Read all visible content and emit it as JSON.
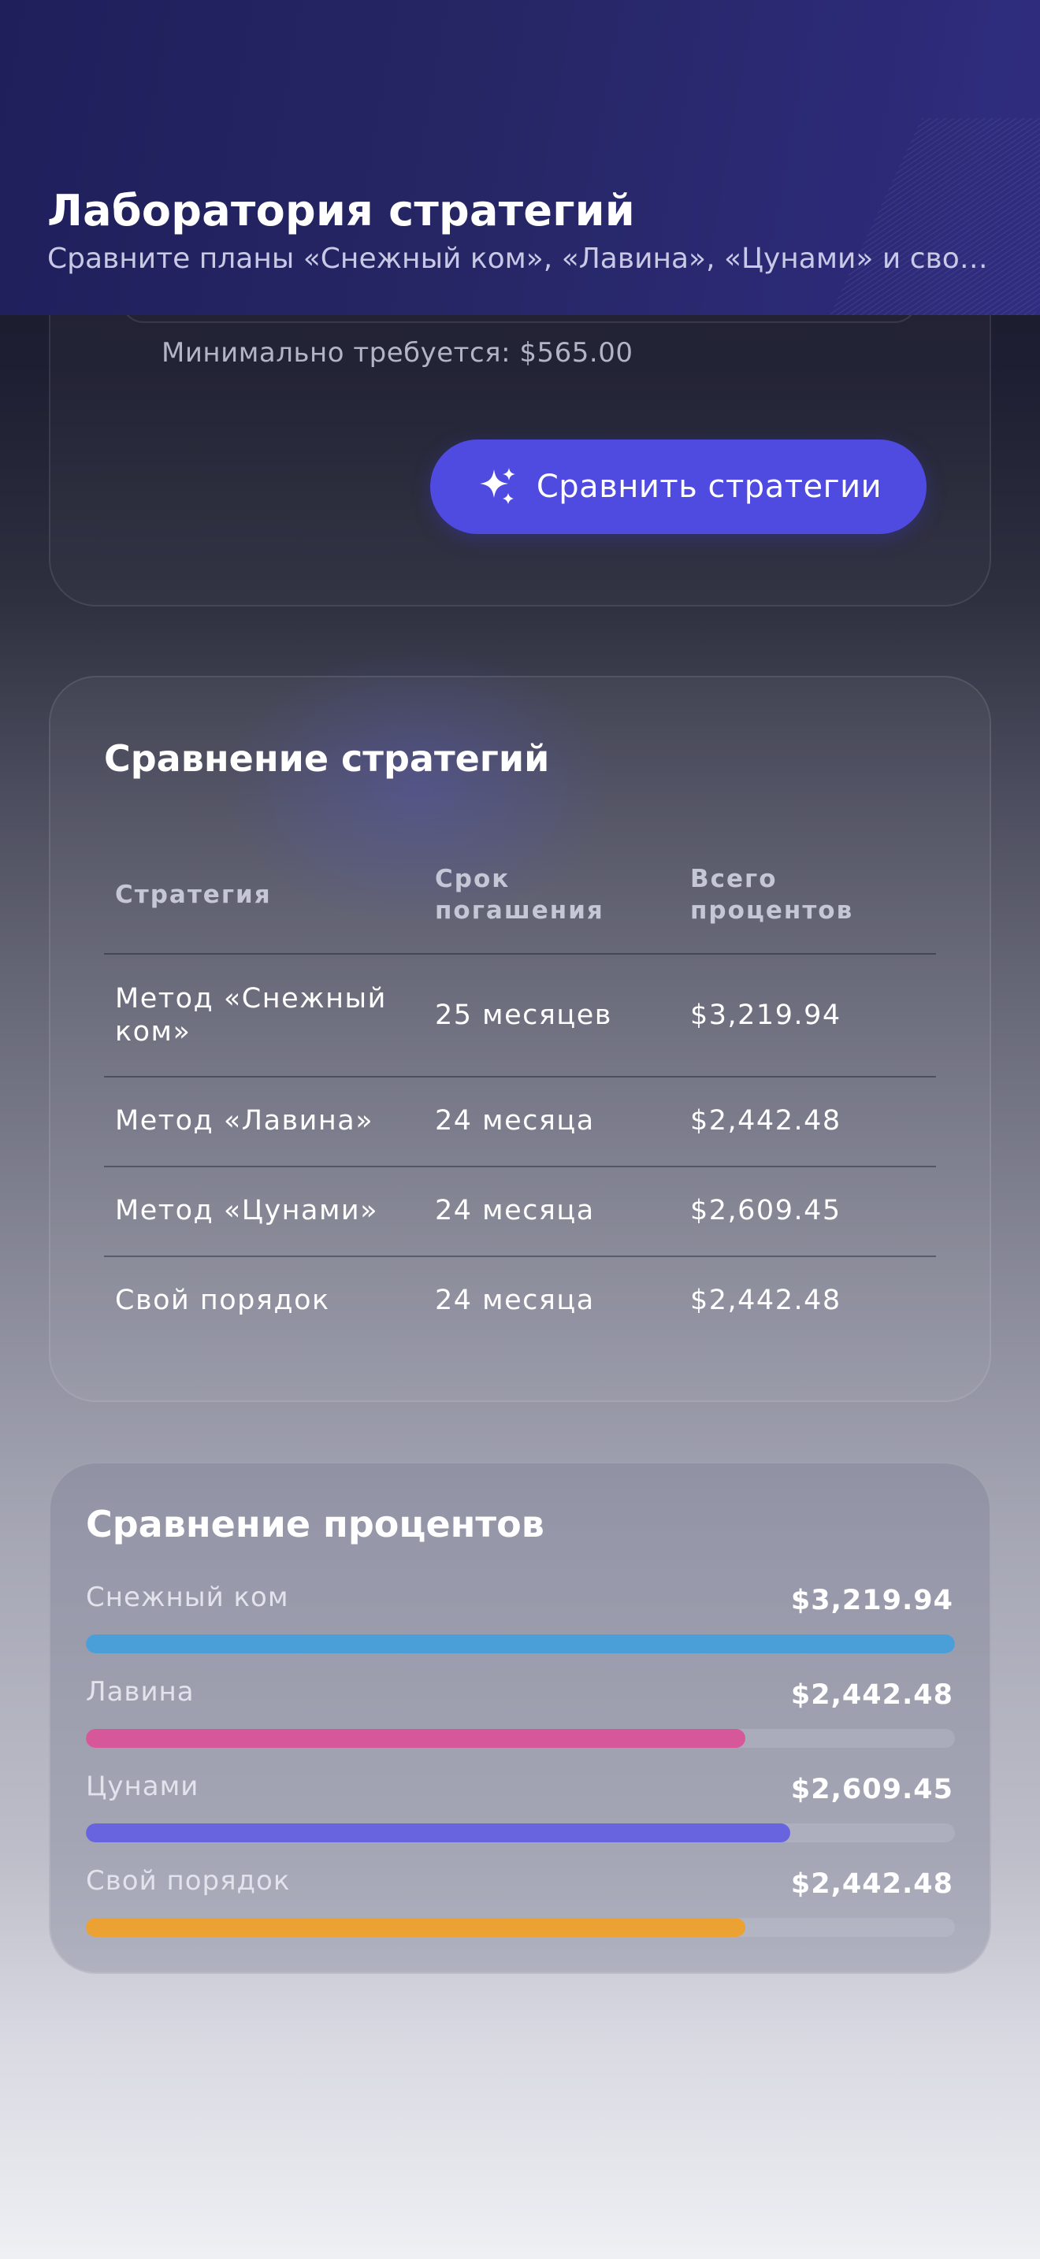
{
  "header": {
    "title": "Лаборатория стратегий",
    "subtitle": "Сравните планы «Снежный ком», «Лавина», «Цунами» и свой..."
  },
  "payment_form": {
    "min_required": "Минимально требуется: $565.00",
    "compare_button_label": "Сравнить стратегии",
    "compare_button_icon": "sparkles-icon"
  },
  "strategy_table": {
    "title": "Сравнение стратегий",
    "columns": [
      "Стратегия",
      "Срок погашения",
      "Всего процентов"
    ],
    "rows": [
      {
        "strategy": "Метод «Снежный ком»",
        "term": "25 месяцев",
        "interest": "$3,219.94"
      },
      {
        "strategy": "Метод «Лавина»",
        "term": "24 месяца",
        "interest": "$2,442.48"
      },
      {
        "strategy": "Метод «Цунами»",
        "term": "24 месяца",
        "interest": "$2,609.45"
      },
      {
        "strategy": "Свой порядок",
        "term": "24 месяца",
        "interest": "$2,442.48"
      }
    ]
  },
  "interest_comparison": {
    "title": "Сравнение процентов",
    "items": [
      {
        "label": "Снежный ком",
        "value": "$3,219.94",
        "amount": 3219.94,
        "color": "#4a9fd8"
      },
      {
        "label": "Лавина",
        "value": "$2,442.48",
        "amount": 2442.48,
        "color": "#d6589b"
      },
      {
        "label": "Цунами",
        "value": "$2,609.45",
        "amount": 2609.45,
        "color": "#6864e0"
      },
      {
        "label": "Свой порядок",
        "value": "$2,442.48",
        "amount": 2442.48,
        "color": "#eba233"
      }
    ]
  }
}
